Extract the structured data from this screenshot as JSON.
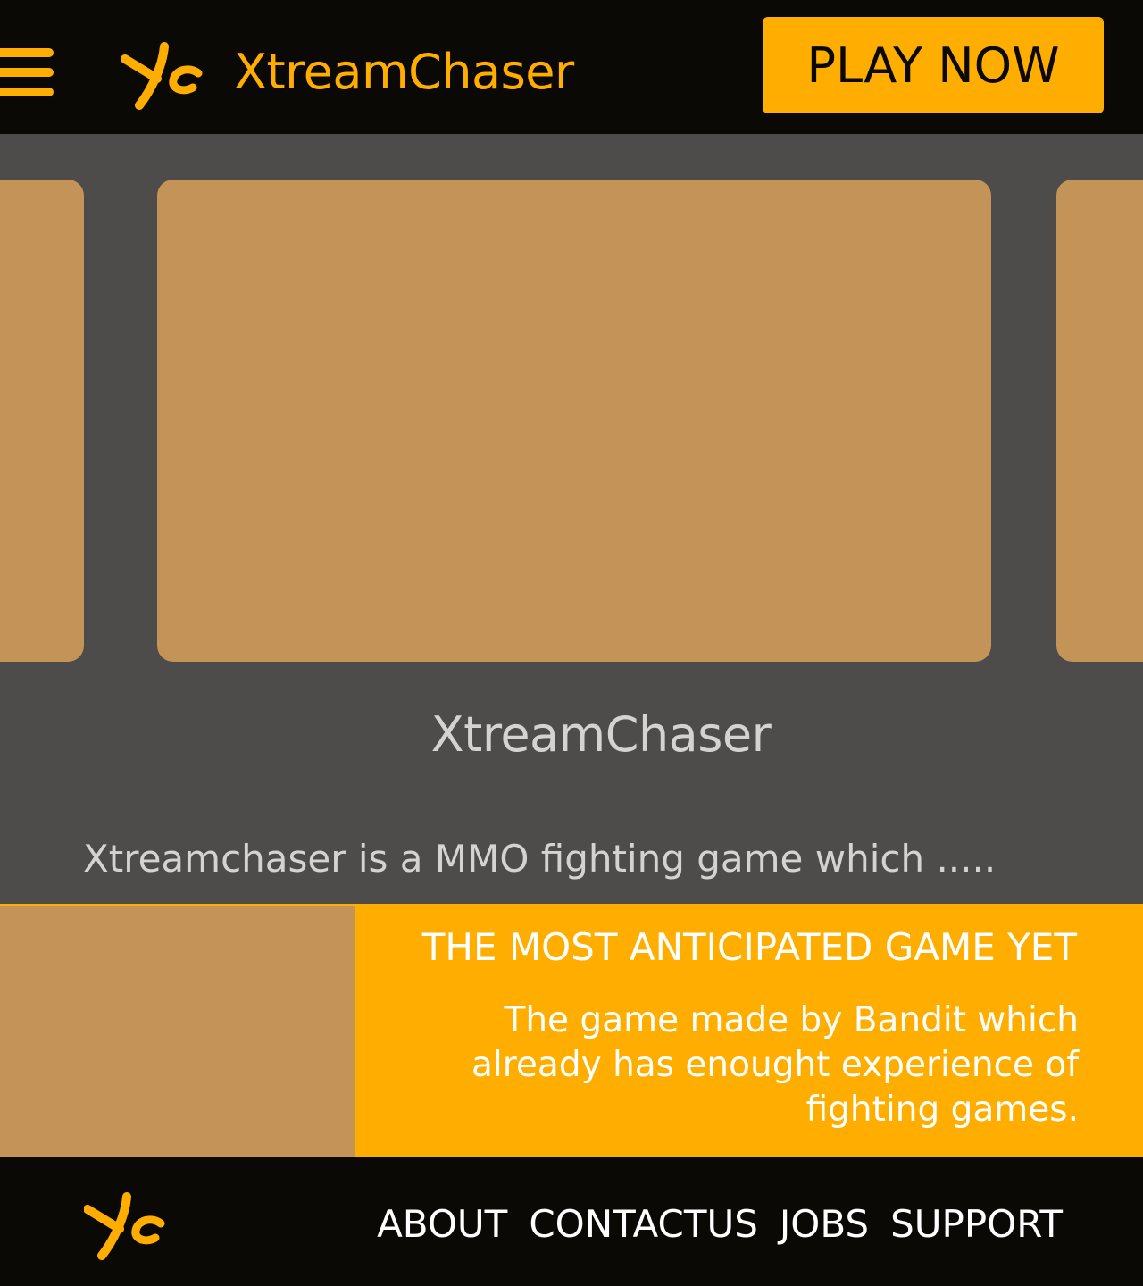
{
  "header": {
    "brand": "XtreamChaser",
    "cta_label": "PLAY NOW"
  },
  "hero": {
    "title": "XtreamChaser",
    "description": "Xtreamchaser is a MMO fighting game which ....."
  },
  "feature": {
    "heading": "THE MOST ANTICIPATED GAME YET",
    "body": "The game made by Bandit which already has enought experience of fighting games."
  },
  "footer": {
    "links": [
      "ABOUT",
      "CONTACTUS",
      "JOBS",
      "SUPPORT"
    ]
  },
  "colors": {
    "accent": "#ffae00",
    "dark": "#0b0905",
    "panel": "#4d4c4b",
    "placeholder": "#c39358",
    "muted_text": "#d4d3d2"
  },
  "icons": {
    "menu": "hamburger-menu-icon",
    "logo": "xc-logo-icon"
  }
}
